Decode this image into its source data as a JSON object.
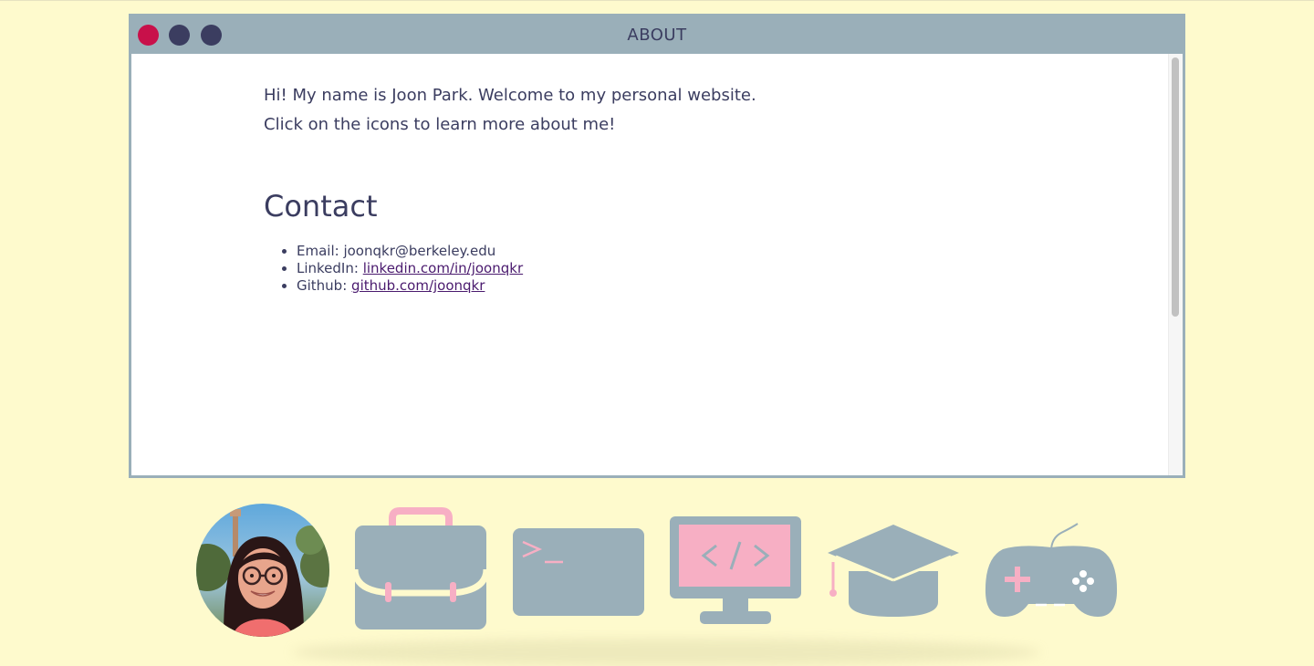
{
  "window": {
    "title": "ABOUT"
  },
  "about": {
    "intro_line1": "Hi! My name is Joon Park. Welcome to my personal website.",
    "intro_line2": "Click on the icons to learn more about me!",
    "contact_heading": "Contact",
    "contacts": [
      {
        "label": "Email:",
        "value": "joonqkr@berkeley.edu"
      },
      {
        "label": "LinkedIn:",
        "link_text": "linkedin.com/in/joonqkr"
      },
      {
        "label": "Github:",
        "link_text": "github.com/joonqkr"
      }
    ]
  },
  "dock": {
    "items": [
      "avatar",
      "briefcase-icon",
      "terminal-icon",
      "code-monitor-icon",
      "graduation-cap-icon",
      "gamepad-icon"
    ]
  },
  "colors": {
    "background": "#fefacd",
    "titlebar": "#9aafb9",
    "close_dot": "#c8104a",
    "dark_dot": "#3b3d60",
    "text": "#3b3d60",
    "icon_gray": "#9aafb9",
    "icon_pink": "#f7afc4"
  }
}
